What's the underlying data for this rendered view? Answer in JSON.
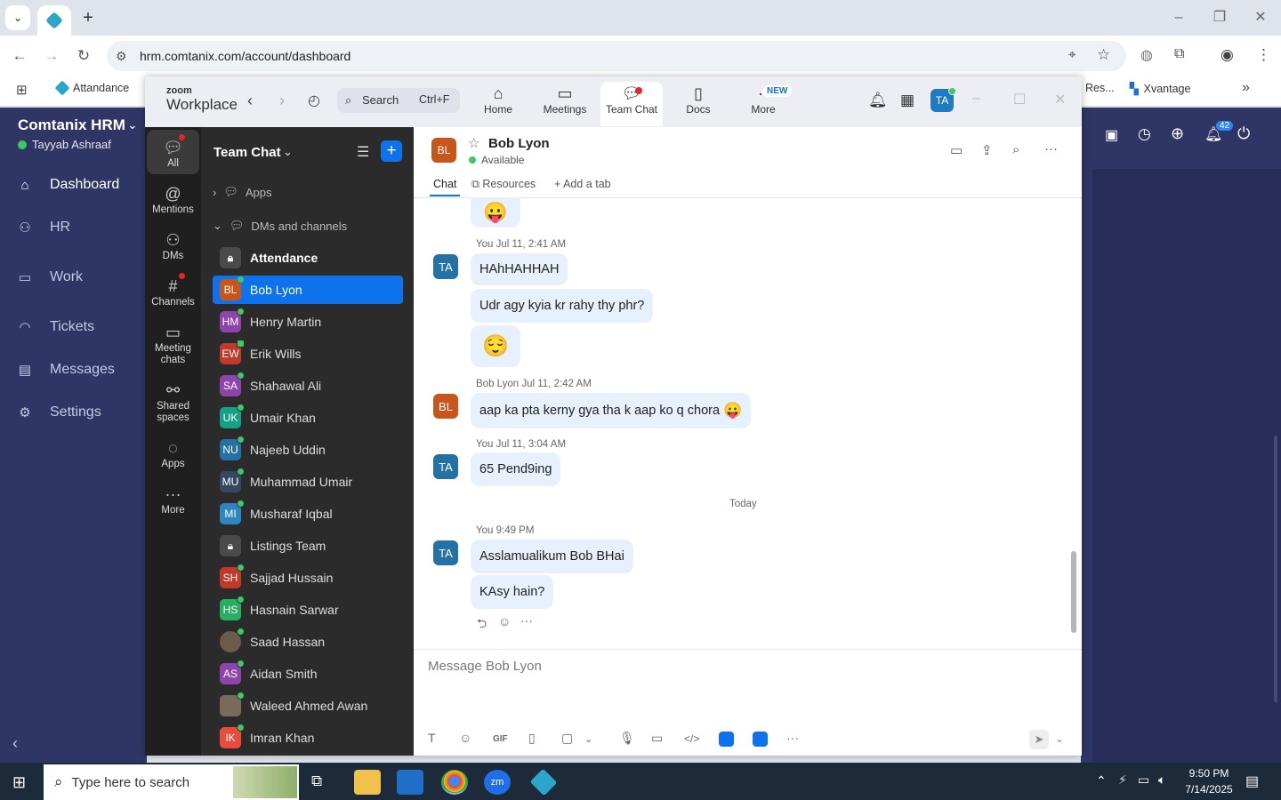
{
  "browser": {
    "url": "hrm.comtanix.com/account/dashboard",
    "bookmarks": [
      "Attandance",
      "Res...",
      "Xvantage"
    ]
  },
  "hrm": {
    "title": "Comtanix HRM",
    "user": "Tayyab Ashraaf",
    "nav": [
      "Dashboard",
      "HR",
      "Work",
      "Tickets",
      "Messages",
      "Settings"
    ],
    "badge": "42"
  },
  "zoom": {
    "logo_top": "zoom",
    "logo_bottom": "Workplace",
    "search": "Search",
    "search_shortcut": "Ctrl+F",
    "tabs": [
      "Home",
      "Meetings",
      "Team Chat",
      "Docs",
      "More"
    ],
    "new_badge": "NEW",
    "avatar": "TA",
    "rail": [
      "All",
      "Mentions",
      "DMs",
      "Channels",
      "Meeting chats",
      "Shared spaces",
      "Apps",
      "More"
    ],
    "list_title": "Team Chat",
    "apps": "Apps",
    "dms": "DMs and channels",
    "contacts": [
      {
        "init": "",
        "name": "Attendance",
        "color": "#4a4a4a"
      },
      {
        "init": "BL",
        "name": "Bob Lyon",
        "color": "#c8561b"
      },
      {
        "init": "HM",
        "name": "Henry Martin",
        "color": "#8e44ad"
      },
      {
        "init": "EW",
        "name": "Erik Wills",
        "color": "#c0392b"
      },
      {
        "init": "SA",
        "name": "Shahawal Ali",
        "color": "#8e44ad"
      },
      {
        "init": "UK",
        "name": "Umair Khan",
        "color": "#16a085"
      },
      {
        "init": "NU",
        "name": "Najeeb Uddin",
        "color": "#2471a3"
      },
      {
        "init": "MU",
        "name": "Muhammad Umair",
        "color": "#34495e"
      },
      {
        "init": "MI",
        "name": "Musharaf Iqbal",
        "color": "#2e86c1"
      },
      {
        "init": "",
        "name": "Listings Team",
        "color": "#4a4a4a"
      },
      {
        "init": "SH",
        "name": "Sajjad Hussain",
        "color": "#c0392b"
      },
      {
        "init": "HS",
        "name": "Hasnain Sarwar",
        "color": "#27ae60"
      },
      {
        "init": "",
        "name": "Saad Hassan",
        "color": "#6b5b4b"
      },
      {
        "init": "AS",
        "name": "Aidan Smith",
        "color": "#8e44ad"
      },
      {
        "init": "",
        "name": "Waleed Ahmed Awan",
        "color": "#7a6a5a"
      },
      {
        "init": "IK",
        "name": "Imran Khan",
        "color": "#e74c3c"
      }
    ],
    "chat": {
      "name": "Bob Lyon",
      "status": "Available",
      "init": "BL",
      "tabs": [
        "Chat",
        "Resources",
        "Add a tab"
      ],
      "meta1": "You Jul 11, 2:41 AM",
      "m1": "HAhHAHHAH",
      "m2": "Udr agy kyia kr rahy thy phr?",
      "meta2": "Bob Lyon Jul 11, 2:42 AM",
      "m3": "aap ka pta kerny gya tha k aap ko q chora",
      "meta3": "You Jul 11, 3:04 AM",
      "m4": "65 Pend9ing",
      "today": "Today",
      "meta4": "You 9:49 PM",
      "m5": "Asslamualikum Bob BHai",
      "m6": "KAsy hain?",
      "placeholder": "Message Bob Lyon",
      "me": "TA"
    }
  },
  "taskbar": {
    "search": "Type here to search",
    "time": "9:50 PM",
    "date": "7/14/2025"
  }
}
